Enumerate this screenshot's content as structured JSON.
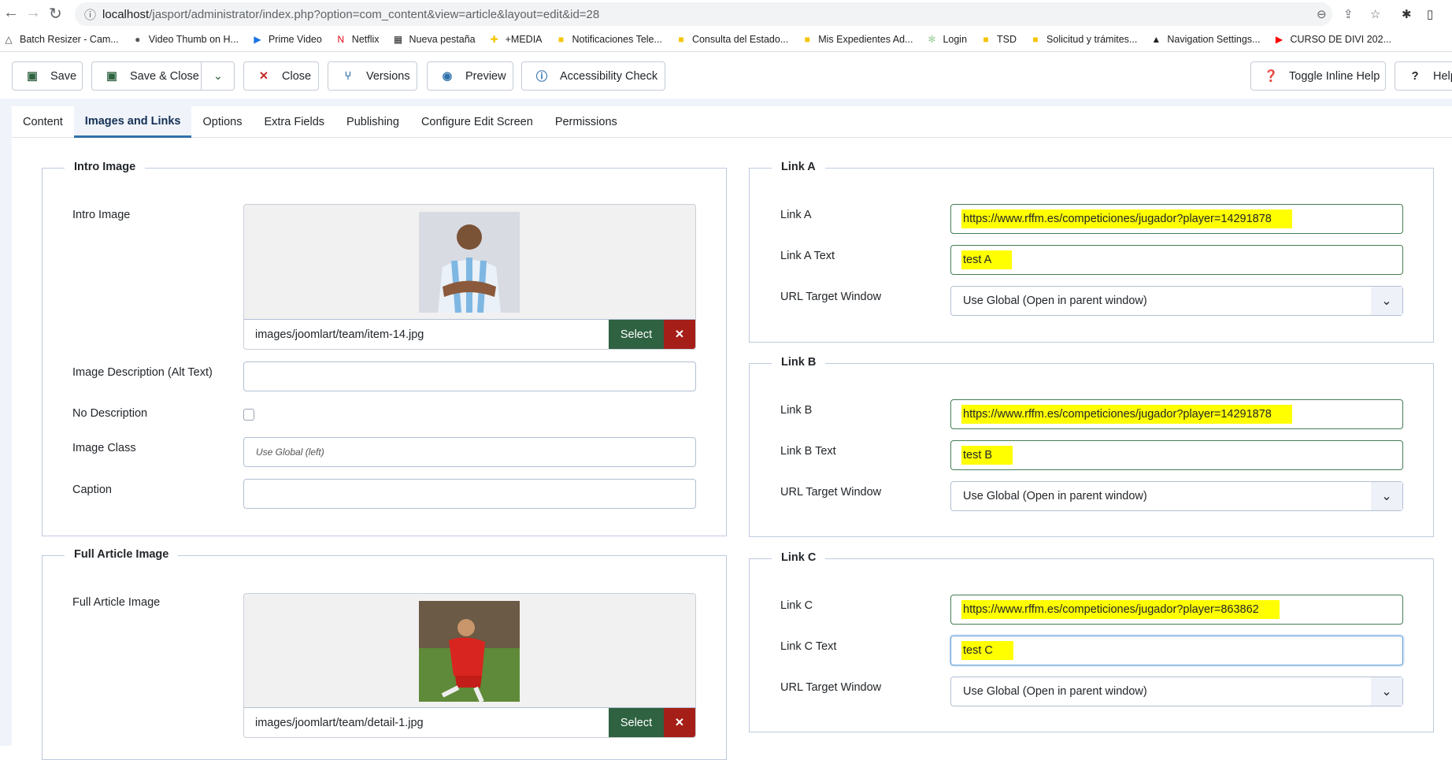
{
  "browser": {
    "url_host": "localhost",
    "url_rest": "/jasport/administrator/index.php?option=com_content&view=article&layout=edit&id=28",
    "bookmarks": [
      {
        "label": "Batch Resizer - Cam...",
        "icon": "triangle-icon"
      },
      {
        "label": "Video Thumb on H...",
        "icon": "globe-icon"
      },
      {
        "label": "Prime Video",
        "icon": "play-icon"
      },
      {
        "label": "Netflix",
        "icon": "netflix-icon"
      },
      {
        "label": "Nueva pestaña",
        "icon": "qr-icon"
      },
      {
        "label": "+MEDIA",
        "icon": "plus-icon"
      },
      {
        "label": "Notificaciones Tele...",
        "icon": "crest-icon"
      },
      {
        "label": "Consulta del Estado...",
        "icon": "crest-icon"
      },
      {
        "label": "Mis Expedientes Ad...",
        "icon": "crest-icon"
      },
      {
        "label": "Login",
        "icon": "spinner-icon"
      },
      {
        "label": "TSD",
        "icon": "crest-icon"
      },
      {
        "label": "Solicitud y trámites...",
        "icon": "crest-icon"
      },
      {
        "label": "Navigation Settings...",
        "icon": "caret-icon"
      },
      {
        "label": "CURSO DE DIVI 202...",
        "icon": "youtube-icon"
      }
    ]
  },
  "toolbar": {
    "save": "Save",
    "save_close": "Save & Close",
    "close": "Close",
    "versions": "Versions",
    "preview": "Preview",
    "accessibility": "Accessibility Check",
    "inline_help": "Toggle Inline Help",
    "help": "Help"
  },
  "tabs": [
    "Content",
    "Images and Links",
    "Options",
    "Extra Fields",
    "Publishing",
    "Configure Edit Screen",
    "Permissions"
  ],
  "intro": {
    "legend": "Intro Image",
    "image_label": "Intro Image",
    "path": "images/joomlart/team/item-14.jpg",
    "select": "Select",
    "alt_label": "Image Description (Alt Text)",
    "alt_value": "",
    "no_desc_label": "No Description",
    "class_label": "Image Class",
    "class_placeholder": "Use Global (left)",
    "caption_label": "Caption",
    "caption_value": ""
  },
  "full": {
    "legend": "Full Article Image",
    "image_label": "Full Article Image",
    "path": "images/joomlart/team/detail-1.jpg",
    "select": "Select"
  },
  "links": [
    {
      "legend": "Link A",
      "link_label": "Link A",
      "link_value": "https://www.rffm.es/competiciones/jugador?player=14291878",
      "text_label": "Link A Text",
      "text_value": "test A",
      "target_label": "URL Target Window",
      "target_value": "Use Global (Open in parent window)"
    },
    {
      "legend": "Link B",
      "link_label": "Link B",
      "link_value": "https://www.rffm.es/competiciones/jugador?player=14291878",
      "text_label": "Link B Text",
      "text_value": "test B",
      "target_label": "URL Target Window",
      "target_value": "Use Global (Open in parent window)"
    },
    {
      "legend": "Link C",
      "link_label": "Link C",
      "link_value": "https://www.rffm.es/competiciones/jugador?player=863862",
      "text_label": "Link C Text",
      "text_value": "test C",
      "target_label": "URL Target Window",
      "target_value": "Use Global (Open in parent window)"
    }
  ]
}
